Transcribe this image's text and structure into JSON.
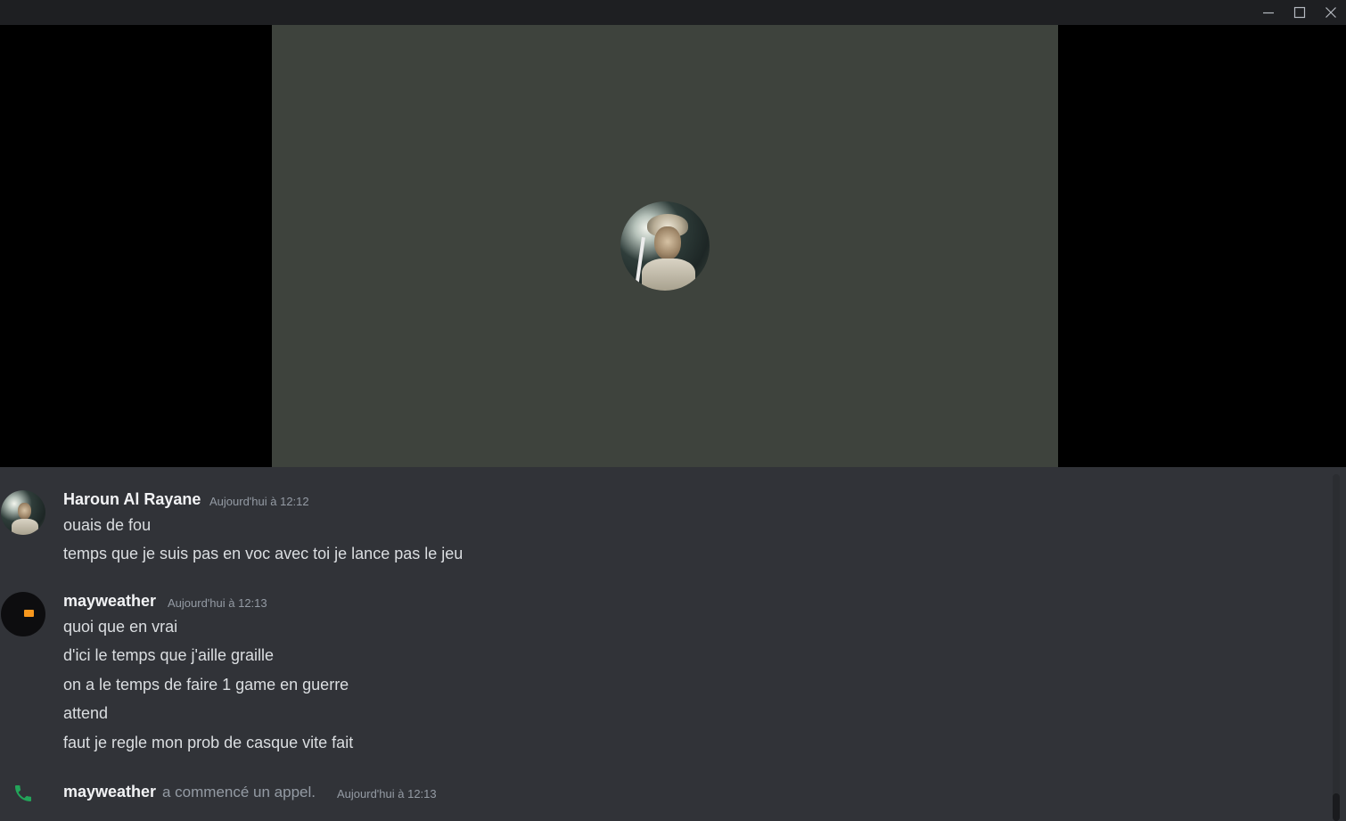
{
  "window": {
    "controls": [
      "minimize-icon",
      "maximize-icon",
      "close-icon"
    ]
  },
  "call": {
    "tile_color": "#3e433d",
    "background_color": "#000000",
    "participant_avatar": "user-avatar"
  },
  "messages": [
    {
      "author": "Haroun Al Rayane",
      "timestamp": "Aujourd'hui à 12:12",
      "lines": [
        "ouais de fou",
        "temps que je suis pas en voc avec toi je lance pas le jeu"
      ]
    },
    {
      "author": "mayweather",
      "timestamp": "Aujourd'hui à 12:13",
      "lines": [
        "quoi que en vrai",
        "d'ici le temps que j'aille graille",
        "on a le temps de faire 1 game en guerre",
        "attend",
        "faut je regle mon prob de casque vite fait"
      ]
    }
  ],
  "system_message": {
    "icon": "phone-icon",
    "author": "mayweather",
    "text": "a commencé un appel.",
    "timestamp": "Aujourd'hui à 12:13",
    "icon_color": "#23a55a"
  },
  "colors": {
    "chat_background": "#313338",
    "titlebar": "#1e1f22",
    "author_text": "#f2f3f5",
    "message_text": "#dbdee1",
    "muted_text": "#949ba4"
  }
}
